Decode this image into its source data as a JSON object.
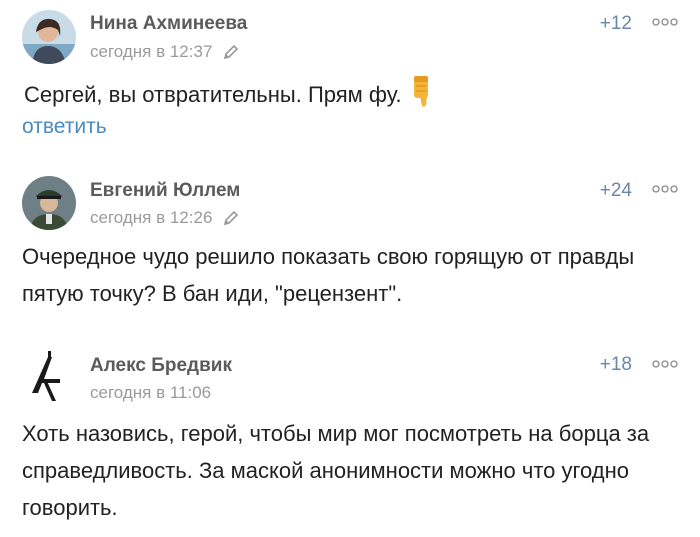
{
  "comments": [
    {
      "author": "Нина Ахминеева",
      "time": "сегодня в 12:37",
      "score": "+12",
      "text": "Сергей, вы отвратительны. Прям фу.",
      "reply_label": "ответить",
      "avatar_icon": "woman-photo"
    },
    {
      "author": "Евгений Юллем",
      "time": "сегодня в 12:26",
      "score": "+24",
      "text": "Очередное чудо решило показать свою горящую от правды пятую точку? В бан иди, \"рецензент\".",
      "avatar_icon": "soldier-photo"
    },
    {
      "author": "Алекс Бредвик",
      "time": "сегодня в 11:06",
      "score": "+18",
      "text": "Хоть назовись, герой, чтобы мир мог посмотреть на борца за справедливость. За маской анонимности можно что угодно говорить.",
      "avatar_icon": "rifle-logo"
    }
  ],
  "colors": {
    "score": "#6a86a8",
    "reply_link": "#4a8bc0",
    "meta": "#9a9a9a"
  }
}
